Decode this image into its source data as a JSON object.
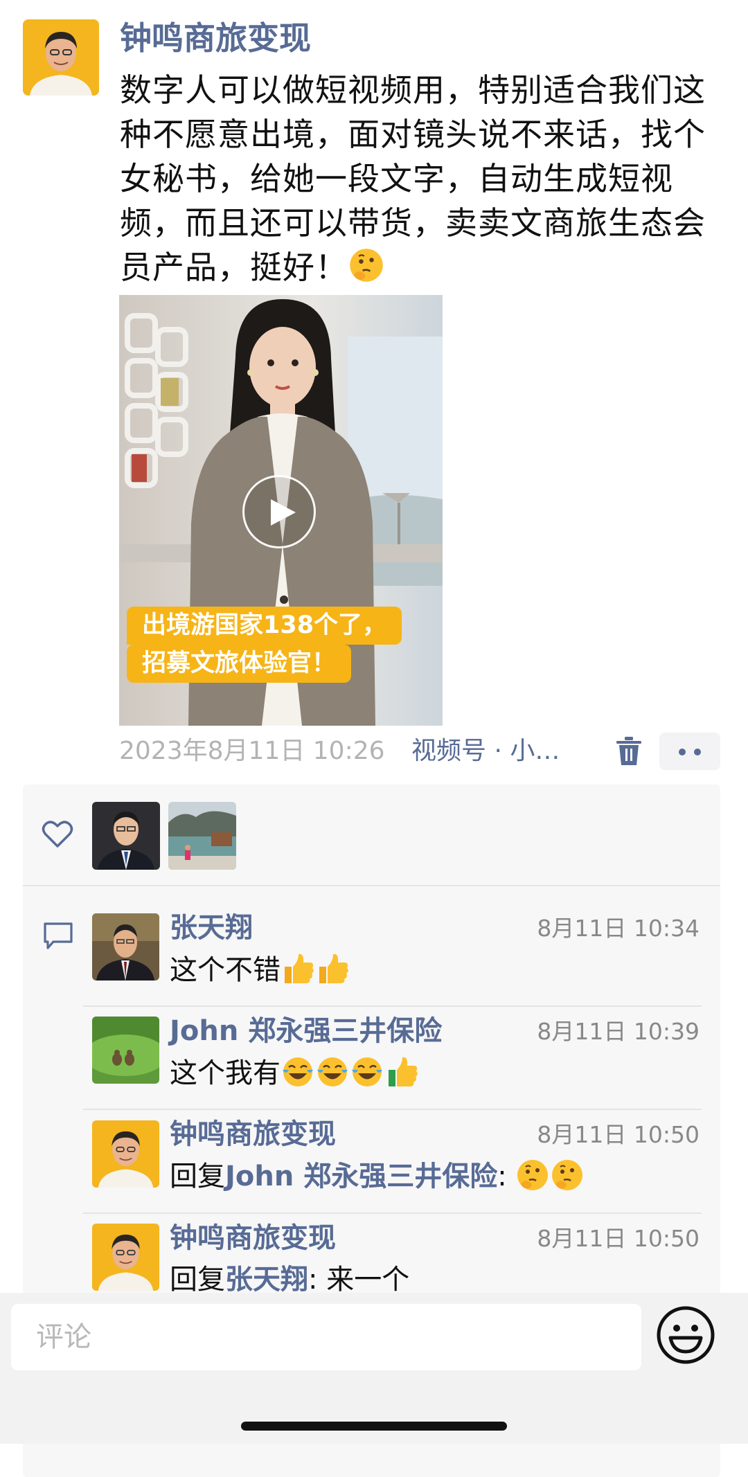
{
  "post": {
    "author": "钟鸣商旅变现",
    "text": "数字人可以做短视频用，特别适合我们这种不愿意出境，面对镜头说不来话，找个女秘书，给她一段文字，自动生成短视频，而且还可以带货，卖卖文商旅生态会员产品，挺好！",
    "video": {
      "caption_line1": "出境游国家138个了，",
      "caption_line2": "招募文旅体验官！"
    },
    "time": "2023年8月11日 10:26",
    "source": "视频号 · 小…"
  },
  "likes": {
    "icon": "heart-outline-icon",
    "avatars": [
      "avatar-man-suit",
      "avatar-lake-scene"
    ]
  },
  "comments": [
    {
      "name": "张天翔",
      "time": "8月11日 10:34",
      "text": "这个不错",
      "emojis": [
        "thumbs-up",
        "thumbs-up"
      ]
    },
    {
      "name": "John 郑永强三井保险",
      "time": "8月11日 10:39",
      "text": "这个我有",
      "emojis": [
        "tears-of-joy",
        "tears-of-joy",
        "tears-of-joy",
        "thumbs-up"
      ]
    },
    {
      "name": "钟鸣商旅变现",
      "time": "8月11日 10:50",
      "reply_prefix": "回复",
      "reply_to": "John 郑永强三井保险",
      "text": ": ",
      "emojis": [
        "thinking",
        "thinking"
      ]
    },
    {
      "name": "钟鸣商旅变现",
      "time": "8月11日 10:50",
      "reply_prefix": "回复",
      "reply_to": "张天翔",
      "text": ": 来一个"
    }
  ],
  "input": {
    "placeholder": "评论"
  },
  "colors": {
    "link": "#576b95",
    "caption_bg": "#f6b417",
    "panel_bg": "#f7f7f7"
  }
}
